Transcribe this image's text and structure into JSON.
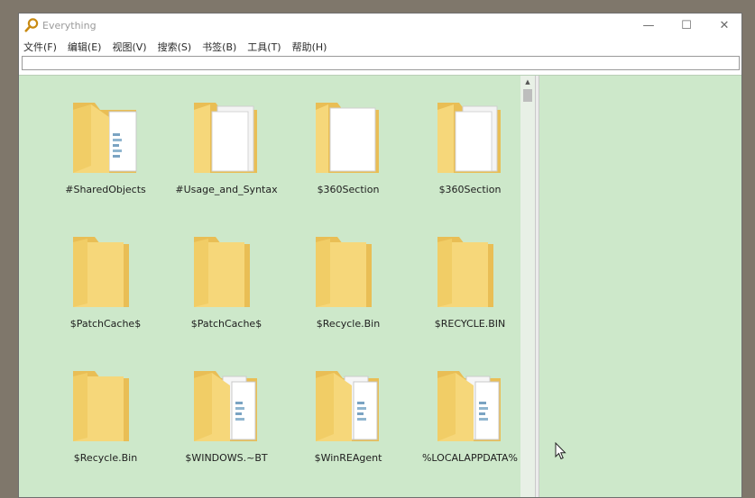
{
  "window": {
    "title": "Everything",
    "min_glyph": "—",
    "max_glyph": "☐",
    "close_glyph": "✕"
  },
  "menu": [
    {
      "label": "文件(F)"
    },
    {
      "label": "编辑(E)"
    },
    {
      "label": "视图(V)"
    },
    {
      "label": "搜索(S)"
    },
    {
      "label": "书签(B)"
    },
    {
      "label": "工具(T)"
    },
    {
      "label": "帮助(H)"
    }
  ],
  "search": {
    "value": "",
    "placeholder": ""
  },
  "items": [
    {
      "name": "#SharedObjects",
      "icon": "folder-with-files-icon"
    },
    {
      "name": "#Usage_and_Syntax",
      "icon": "folder-with-documents-icon"
    },
    {
      "name": "$360Section",
      "icon": "folder-with-document-icon"
    },
    {
      "name": "$360Section",
      "icon": "folder-with-documents-icon"
    },
    {
      "name": "$PatchCache$",
      "icon": "folder-icon"
    },
    {
      "name": "$PatchCache$",
      "icon": "folder-icon"
    },
    {
      "name": "$Recycle.Bin",
      "icon": "folder-icon"
    },
    {
      "name": "$RECYCLE.BIN",
      "icon": "folder-icon"
    },
    {
      "name": "$Recycle.Bin",
      "icon": "folder-icon"
    },
    {
      "name": "$WINDOWS.~BT",
      "icon": "folder-with-files-icon"
    },
    {
      "name": "$WinREAgent",
      "icon": "folder-with-files-icon"
    },
    {
      "name": "%LOCALAPPDATA%",
      "icon": "folder-with-files-icon"
    }
  ],
  "scrollbar": {
    "up_glyph": "▲"
  },
  "colors": {
    "content_bg": "#cde8ca",
    "folder": "#f6d77a",
    "folder_dark": "#e9be55"
  }
}
